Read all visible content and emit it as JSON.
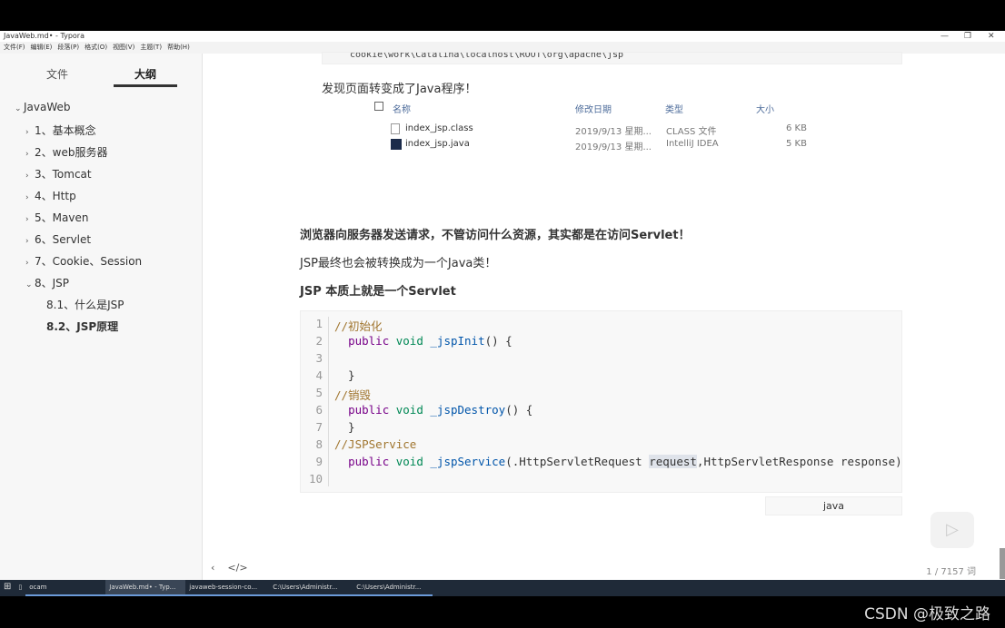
{
  "window": {
    "title": "JavaWeb.md• - Typora",
    "controls": [
      "—",
      "❐",
      "✕"
    ]
  },
  "menu": [
    "文件(F)",
    "编辑(E)",
    "段落(P)",
    "格式(O)",
    "视图(V)",
    "主题(T)",
    "帮助(H)"
  ],
  "sidebar": {
    "tabs": [
      "文件",
      "大纲"
    ],
    "active_tab": "大纲",
    "outline": [
      {
        "label": "JavaWeb",
        "level": 0,
        "chev": "⌄"
      },
      {
        "label": "1、基本概念",
        "level": 1,
        "chev": "›"
      },
      {
        "label": "2、web服务器",
        "level": 1,
        "chev": "›"
      },
      {
        "label": "3、Tomcat",
        "level": 1,
        "chev": "›"
      },
      {
        "label": "4、Http",
        "level": 1,
        "chev": "›"
      },
      {
        "label": "5、Maven",
        "level": 1,
        "chev": "›"
      },
      {
        "label": "6、Servlet",
        "level": 1,
        "chev": "›"
      },
      {
        "label": "7、Cookie、Session",
        "level": 1,
        "chev": "›"
      },
      {
        "label": "8、JSP",
        "level": 1,
        "chev": "⌄"
      },
      {
        "label": "8.1、什么是JSP",
        "level": 2,
        "chev": ""
      },
      {
        "label": "8.2、JSP原理",
        "level": 2,
        "chev": "",
        "active": true
      }
    ]
  },
  "content": {
    "code_prev": "cookie\\work\\Catalina\\localhost\\ROOT\\org\\apache\\jsp",
    "p1": "发现页面转变成了Java程序！",
    "explorer": {
      "headers": [
        "名称",
        "修改日期",
        "类型",
        "大小"
      ],
      "rows": [
        {
          "name": "index_jsp.class",
          "date": "2019/9/13 星期...",
          "type": "CLASS 文件",
          "size": "6 KB"
        },
        {
          "name": "index_jsp.java",
          "date": "2019/9/13 星期...",
          "type": "IntelliJ IDEA",
          "size": "5 KB"
        }
      ]
    },
    "p2": "浏览器向服务器发送请求，不管访问什么资源，其实都是在访问Servlet！",
    "p3": "JSP最终也会被转换成为一个Java类！",
    "p4": "JSP 本质上就是一个Servlet",
    "code_lang": "java",
    "word_count": "1 / 7157 词"
  },
  "taskbar": [
    "ocam",
    "JavaWeb.md• - Typ...",
    "javaweb-session-co...",
    "C:\\Users\\Administr...",
    "C:\\Users\\Administr..."
  ],
  "watermark": "CSDN @极致之路"
}
